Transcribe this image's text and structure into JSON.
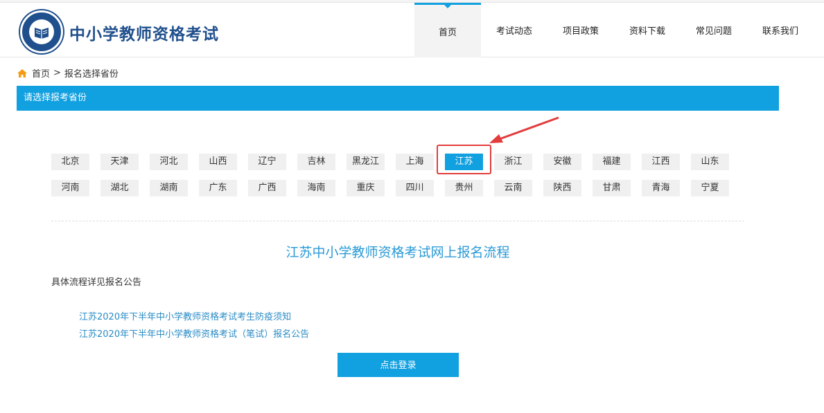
{
  "site": {
    "title": "中小学教师资格考试"
  },
  "nav": [
    {
      "label": "首页",
      "active": true
    },
    {
      "label": "考试动态"
    },
    {
      "label": "项目政策"
    },
    {
      "label": "资料下载"
    },
    {
      "label": "常见问题"
    },
    {
      "label": "联系我们"
    }
  ],
  "breadcrumb": {
    "home": "首页",
    "separator": ">",
    "current": "报名选择省份"
  },
  "panel": {
    "heading": "请选择报考省份"
  },
  "provinces": {
    "row1": [
      "北京",
      "天津",
      "河北",
      "山西",
      "辽宁",
      "吉林",
      "黑龙江",
      "上海",
      "江苏",
      "浙江",
      "安徽",
      "福建",
      "江西",
      "山东"
    ],
    "row2": [
      "河南",
      "湖北",
      "湖南",
      "广东",
      "广西",
      "海南",
      "重庆",
      "四川",
      "贵州",
      "云南",
      "陕西",
      "甘肃",
      "青海",
      "宁夏"
    ],
    "selected": "江苏"
  },
  "process": {
    "title": "江苏中小学教师资格考试网上报名流程",
    "note": "具体流程详见报名公告",
    "links": [
      "江苏2020年下半年中小学教师资格考试考生防疫须知",
      "江苏2020年下半年中小学教师资格考试（笔试）报名公告"
    ]
  },
  "login": {
    "label": "点击登录"
  },
  "colors": {
    "accent": "#11a0e0",
    "brand": "#1f4f8c",
    "annotation": "#e23c3c"
  }
}
